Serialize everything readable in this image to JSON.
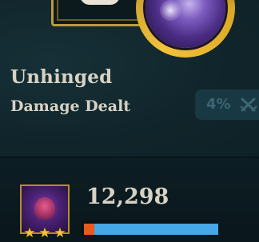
{
  "trait": {
    "name": "Unhinged",
    "stat_label": "Damage Dealt",
    "percent_text": "4%",
    "emblem_icon": "unhinged-trait-emblem-icon"
  },
  "unit": {
    "portrait_icon": "champion-portrait-icon",
    "star_icon": "star-icon",
    "stars": [
      "★",
      "★",
      "★"
    ],
    "damage_value": "12,298",
    "damage_split": {
      "physical_fraction": 0.08,
      "magic_fraction": 0.92
    }
  },
  "colors": {
    "gold": "#d9a825",
    "physical": "#e85a1a",
    "magic": "#45a7e6",
    "text": "#d7d2c3",
    "background": "#0e2329"
  }
}
